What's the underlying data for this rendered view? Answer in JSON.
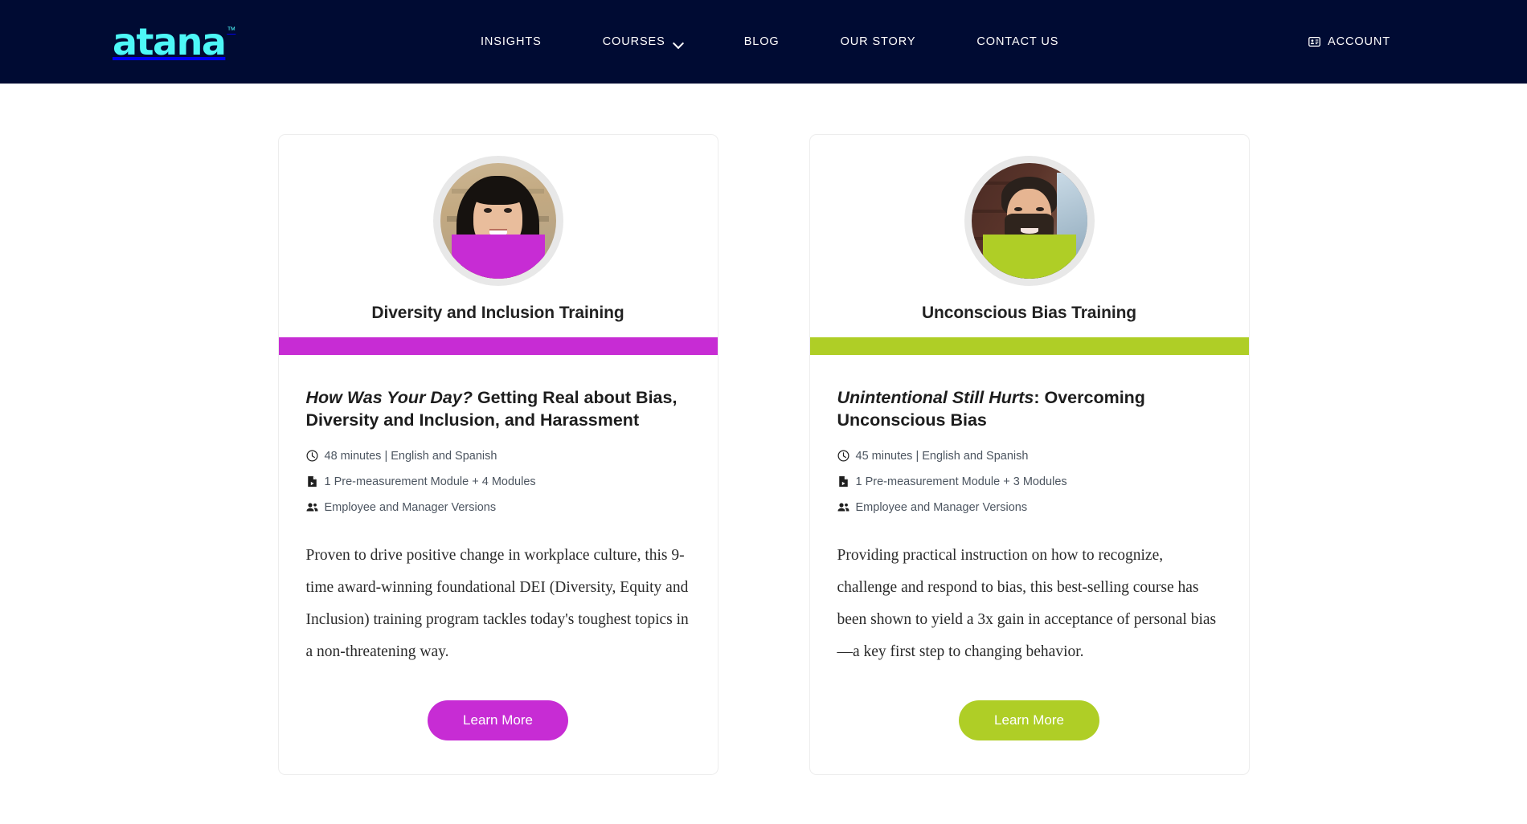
{
  "header": {
    "logo_text": "atana",
    "logo_tm": "™",
    "logo_color": "#4df7f7",
    "background_color": "#000b33",
    "nav": [
      {
        "label": "INSIGHTS",
        "has_dropdown": false
      },
      {
        "label": "COURSES",
        "has_dropdown": true,
        "icon": "chevron-down-icon"
      },
      {
        "label": "BLOG",
        "has_dropdown": false
      },
      {
        "label": "OUR STORY",
        "has_dropdown": false
      },
      {
        "label": "CONTACT US",
        "has_dropdown": false
      }
    ],
    "account": {
      "label": "ACCOUNT",
      "icon": "id-card-icon"
    }
  },
  "cards": [
    {
      "category_title": "Diversity and Inclusion Training",
      "accent_color": "#c72cd4",
      "avatar": {
        "icon": "avatar-photo-woman",
        "ring_color": "#e8e8e8"
      },
      "heading_italic": "How Was Your Day?",
      "heading_rest": " Getting Real about Bias, Diversity and Inclusion, and Harassment",
      "meta": [
        {
          "icon": "clock-icon",
          "text": "48 minutes | English and Spanish"
        },
        {
          "icon": "module-file-icon",
          "text": "1 Pre-measurement Module + 4 Modules"
        },
        {
          "icon": "users-icon",
          "text": "Employee and Manager Versions"
        }
      ],
      "description": "Proven to drive positive change in workplace culture, this 9-time award-winning foundational DEI (Diversity, Equity and Inclusion) training program tackles today's toughest topics in a non-threatening way.",
      "button_label": "Learn More"
    },
    {
      "category_title": "Unconscious Bias Training",
      "accent_color": "#afce26",
      "avatar": {
        "icon": "avatar-photo-man",
        "ring_color": "#e8e8e8"
      },
      "heading_italic": "Unintentional Still Hurts",
      "heading_rest": ": Overcoming Unconscious Bias",
      "meta": [
        {
          "icon": "clock-icon",
          "text": "45 minutes | English and Spanish"
        },
        {
          "icon": "module-file-icon",
          "text": "1 Pre-measurement Module + 3 Modules"
        },
        {
          "icon": "users-icon",
          "text": "Employee and Manager Versions"
        }
      ],
      "description": "Providing practical instruction on how to recognize, challenge and respond to bias, this best-selling course has been shown to yield a 3x gain in acceptance of personal bias—a key first step to changing behavior.",
      "button_label": "Learn More"
    }
  ]
}
